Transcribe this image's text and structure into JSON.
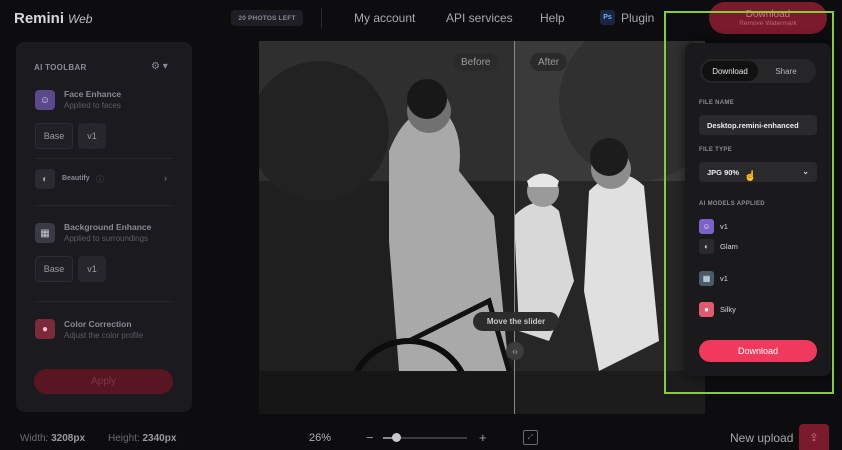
{
  "header": {
    "logo": "Remini",
    "logo_suffix": "Web",
    "credits": "20 PHOTOS LEFT",
    "nav": [
      "My account",
      "API services",
      "Help"
    ],
    "plugin_label": "Plugin",
    "plugin_icon_text": "Ps",
    "download_label": "Download",
    "remove_watermark": "Remove Watermark"
  },
  "toolbar": {
    "title": "AI TOOLBAR",
    "face": {
      "title": "Face Enhance",
      "subtitle": "Applied to faces",
      "base": "Base",
      "version": "v1"
    },
    "beautify": {
      "title": "Beautify"
    },
    "background": {
      "title": "Background Enhance",
      "subtitle": "Applied to surroundings",
      "base": "Base",
      "version": "v1"
    },
    "color": {
      "title": "Color Correction",
      "subtitle": "Adjust the color profile"
    },
    "apply": "Apply"
  },
  "viewer": {
    "before": "Before",
    "after": "After",
    "move_hint": "Move the slider"
  },
  "bottom": {
    "width_label": "Width:",
    "width_value": "3208px",
    "height_label": "Height:",
    "height_value": "2340px",
    "zoom": "26%",
    "zoom_fraction": 0.15,
    "new_upload": "New upload"
  },
  "download_panel": {
    "tabs": [
      "Download",
      "Share"
    ],
    "active_tab": "Download",
    "file_name_label": "FILE NAME",
    "file_name": "Desktop.remini-enhanced",
    "file_type_label": "FILE TYPE",
    "file_type": "JPG 90%",
    "models_label": "AI MODELS APPLIED",
    "models": [
      "v1",
      "Glam",
      "v1",
      "Silky"
    ],
    "button": "Download"
  },
  "colors": {
    "accent": "#ef3a5d",
    "highlight": "#86cc3a"
  }
}
